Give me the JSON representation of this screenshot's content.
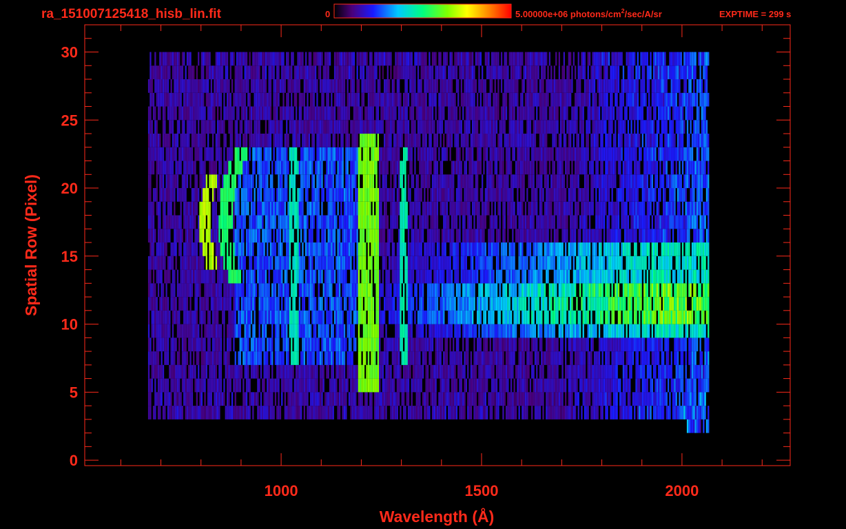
{
  "colors": {
    "text": "#ff2a1a",
    "axis": "#ff2a1a",
    "background": "#000000"
  },
  "header": {
    "filename": "ra_151007125418_hisb_lin.fit",
    "colorbar_min": "0",
    "colorbar_max_prefix": "5.00000e+06 photons/cm",
    "colorbar_max_sup": "2",
    "colorbar_max_suffix": "/sec/A/sr",
    "exptime": "EXPTIME = 299 s"
  },
  "chart_data": {
    "type": "heatmap",
    "xlabel": "Wavelength (Å)",
    "ylabel": "Spatial Row (Pixel)",
    "xlim": [
      510,
      2270
    ],
    "ylim": [
      -0.4,
      32
    ],
    "x_ticks": [
      1000,
      1500,
      2000
    ],
    "x_tick_labels": [
      "1000",
      "1500",
      "2000"
    ],
    "y_ticks": [
      0,
      5,
      10,
      15,
      20,
      25,
      30
    ],
    "y_tick_labels": [
      "0",
      "5",
      "10",
      "15",
      "20",
      "25",
      "30"
    ],
    "colorbar": {
      "min": 0,
      "max": 5000000,
      "units": "photons/cm^2/sec/A/sr",
      "colormap": "rainbow"
    },
    "exposure_time_s": 299,
    "grid": false,
    "features": [
      {
        "name": "bright arc",
        "x": [
          800,
          860
        ],
        "rows": [
          14,
          20
        ],
        "intensity": 0.62
      },
      {
        "name": "arc",
        "x": [
          840,
          920
        ],
        "rows": [
          13,
          22
        ],
        "intensity": 0.5
      },
      {
        "name": "line",
        "x": 1030,
        "rows": [
          7,
          22
        ],
        "intensity": 0.42
      },
      {
        "name": "line",
        "x": 1215,
        "rows": [
          5,
          24
        ],
        "intensity": 0.62
      },
      {
        "name": "line",
        "x": 1304,
        "rows": [
          7,
          22
        ],
        "intensity": 0.45
      },
      {
        "name": "continuum band",
        "x": [
          1230,
          2060
        ],
        "rows": [
          9,
          15
        ],
        "intensity": 0.58
      }
    ]
  }
}
